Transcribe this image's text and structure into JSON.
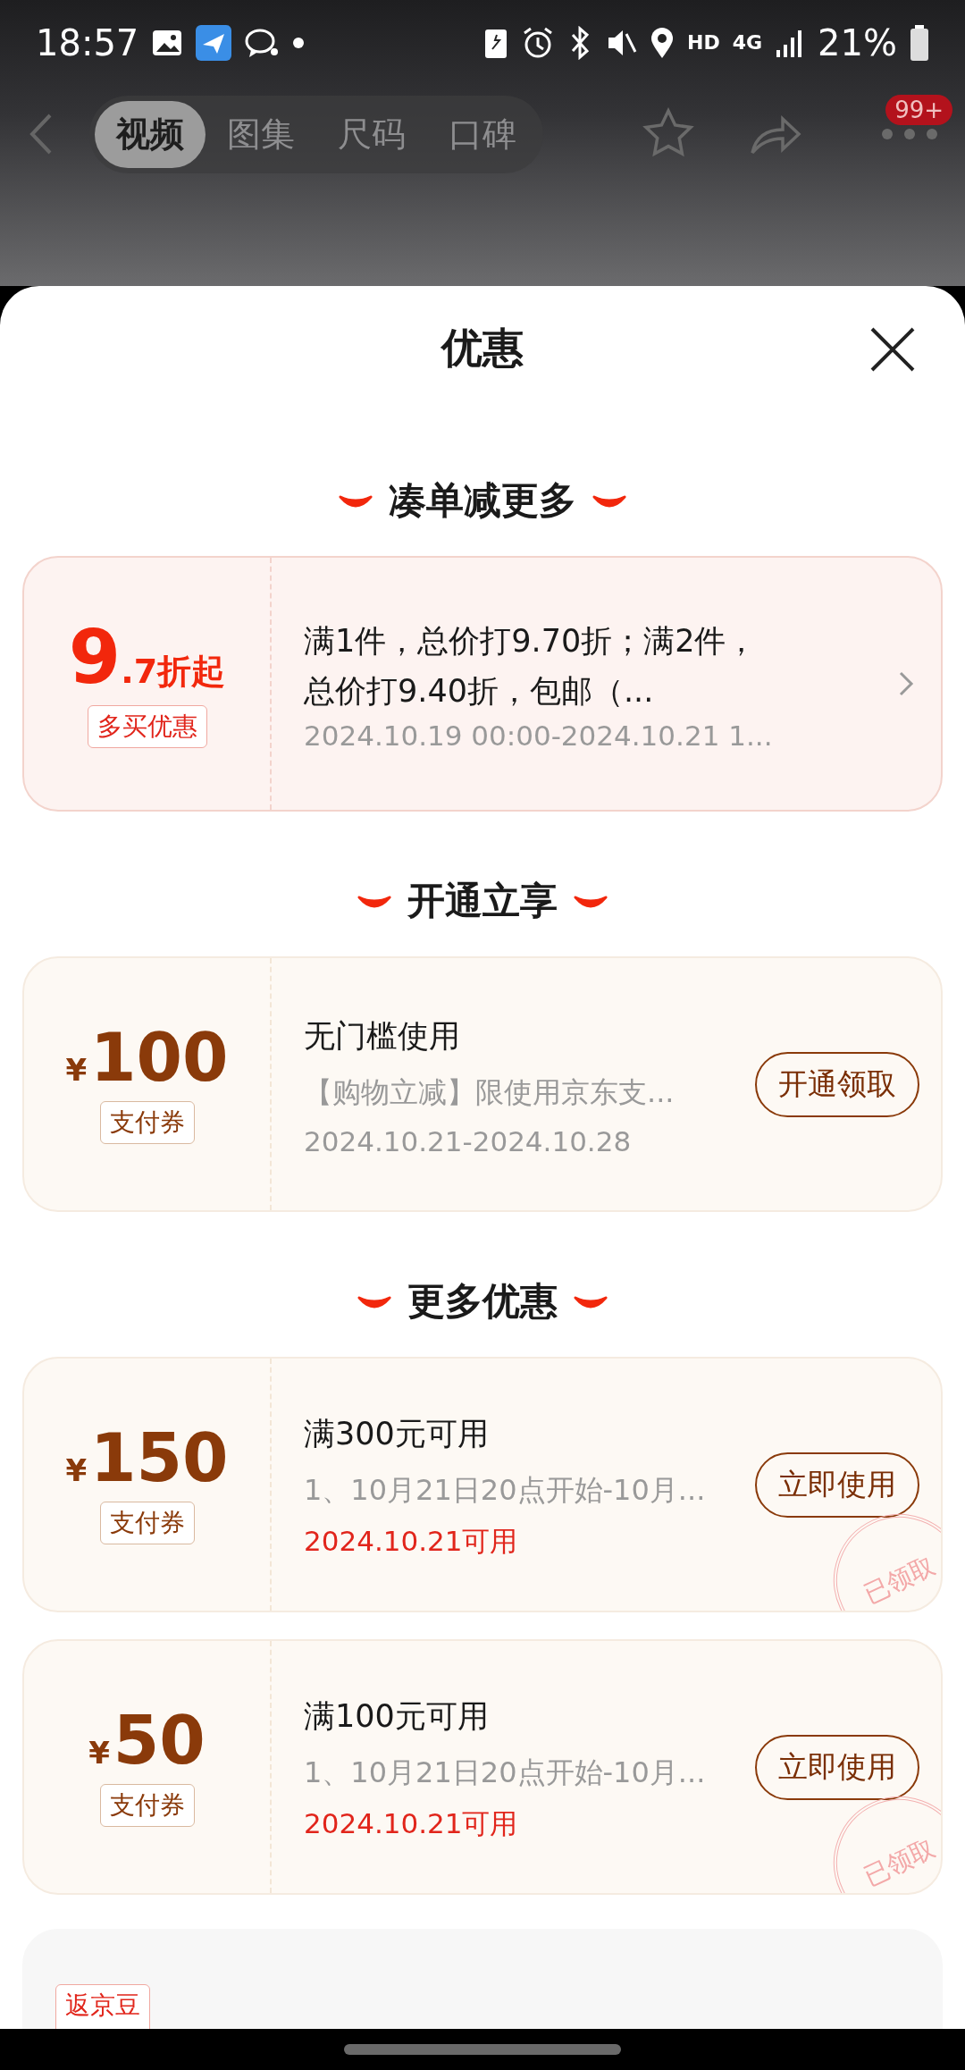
{
  "status_bar": {
    "time": "18:57",
    "hd": "HD",
    "network": "4G",
    "battery": "21%"
  },
  "top_nav": {
    "tabs": [
      {
        "label": "视频",
        "selected": true
      },
      {
        "label": "图集",
        "selected": false
      },
      {
        "label": "尺码",
        "selected": false
      },
      {
        "label": "口碑",
        "selected": false
      }
    ],
    "badge": "99+"
  },
  "sheet": {
    "title": "优惠"
  },
  "sections": [
    {
      "title": "凑单减更多",
      "cards": [
        {
          "kind": "discount",
          "big": "9",
          "small": ".7折起",
          "tag": "多买优惠",
          "title": "满1件，总价打9.70折；满2件，总价打9.40折，包邮（...",
          "validity": "2024.10.19 00:00-2024.10.21 1...",
          "highlighted": false
        }
      ]
    },
    {
      "title": "开通立享",
      "cards": [
        {
          "kind": "coupon",
          "currency": "¥",
          "amount": "100",
          "tag": "支付券",
          "title": "无门槛使用",
          "desc": "【购物立减】限使用京东支...",
          "validity": "2024.10.21-2024.10.28",
          "highlighted": false,
          "button": "开通领取"
        }
      ]
    },
    {
      "title": "更多优惠",
      "cards": [
        {
          "kind": "coupon",
          "currency": "¥",
          "amount": "150",
          "tag": "支付券",
          "title": "满300元可用",
          "desc": "1、10月21日20点开始-10月...",
          "validity": "2024.10.21可用",
          "highlighted": true,
          "button": "立即使用",
          "stamp": "已领取"
        },
        {
          "kind": "coupon",
          "currency": "¥",
          "amount": "50",
          "tag": "支付券",
          "title": "满100元可用",
          "desc": "1、10月21日20点开始-10月...",
          "validity": "2024.10.21可用",
          "highlighted": true,
          "button": "立即使用",
          "stamp": "已领取"
        },
        {
          "kind": "partial",
          "tag": "返京豆"
        }
      ]
    }
  ]
}
